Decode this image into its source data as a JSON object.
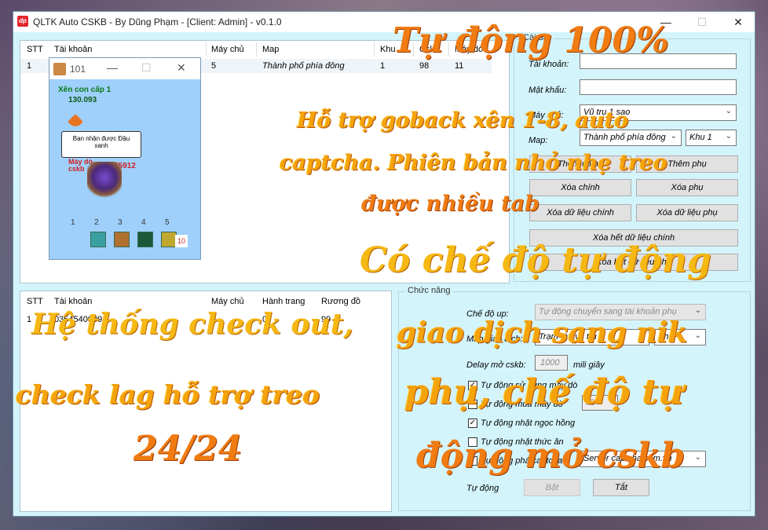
{
  "window": {
    "title": "QLTK Auto CSKB - By Dũng Phạm - [Client: Admin] - v0.1.0",
    "icon": "app-logo-icon",
    "minimize": "—",
    "maximize": "☐",
    "close": "✕"
  },
  "top_table": {
    "columns": [
      "STT",
      "Tài khoản",
      "Máy chủ",
      "Map",
      "Khu",
      "Cskb",
      "Máy dò"
    ],
    "rows": [
      {
        "stt": "1",
        "account": "",
        "server": "5",
        "map": "Thành phố phía đông",
        "zone": "1",
        "cskb": "98",
        "detector": "11"
      }
    ]
  },
  "bottom_table": {
    "columns": [
      "STT",
      "Tài khoản",
      "Máy chủ",
      "Hành trang",
      "Rương đồ"
    ],
    "rows": [
      {
        "stt": "1",
        "account": "0354540009",
        "server": "5",
        "bag": "0",
        "chest": "99"
      }
    ]
  },
  "settings": {
    "legend": "Cài đặt",
    "account_label": "Tài khoản:",
    "account_value": "",
    "password_label": "Mật khẩu:",
    "password_value": "",
    "server_label": "Máy chủ:",
    "server_value": "Vũ trụ 1 sao",
    "map_label": "Map:",
    "map_value": "Thành phố phía đông",
    "zone_value": "Khu 1",
    "buttons": {
      "add_main": "Thêm chính",
      "add_sub": "Thêm phụ",
      "delete_main": "Xóa chính",
      "delete_sub": "Xóa phụ",
      "delete_main_data": "Xóa dữ liệu chính",
      "delete_sub_data": "Xóa dữ liệu phụ",
      "delete_all_main_data": "Xóa hết dữ liệu chính",
      "delete_all_sub_data": "Xóa hết dữ liệu phụ"
    }
  },
  "features": {
    "legend": "Chức năng",
    "mode_label": "Chế độ up:",
    "mode_value": "Tự động chuyển sang tài khoản phụ",
    "trade_label": "Map giao dịch:",
    "trade_value": "Trạm tàu vũ trụ",
    "trade_zone": "Khu",
    "delay_label": "Delay mở cskb:",
    "delay_value": "1000",
    "delay_unit": "mili giây",
    "checkboxes": [
      {
        "label": "Tự động sử dụng máy dò",
        "checked": true
      },
      {
        "label": "Tự động mua máy dò",
        "checked": false,
        "extra": "x3"
      },
      {
        "label": "Tự động nhặt ngọc hồng",
        "checked": true
      },
      {
        "label": "Tự động nhặt thức ăn",
        "checked": false
      },
      {
        "label": "Tự động phá captcha",
        "checked": true
      }
    ],
    "captcha_server": "Server captcha.com.vn",
    "auto_label": "Tự động",
    "on_button": "Bật",
    "off_button": "Tắt"
  },
  "popup": {
    "title": "101",
    "mob_text": "Xên con cấp 1",
    "mob_hp": "130.093",
    "bubble": "Bạn nhận được Đậu xanh",
    "char_label": "Máy dò\ncskb",
    "char_hp": "35912",
    "zones": [
      "1",
      "2",
      "3",
      "4",
      "5"
    ],
    "slot_count": "10"
  },
  "overlays": {
    "promo1": "Tự động 100%",
    "promo2a": "Hỗ trợ goback xên 1-8, auto",
    "promo2b": "captcha. Phiên bản nhỏ nhẹ treo",
    "promo2c": "được nhiều tab",
    "promo3": "Có chế độ tự động",
    "promo4a": "giao dịch sang nik",
    "promo4b": "phụ, chế độ tự",
    "promo4c": "động mở cskb",
    "promo5a": "Hệ thống check out,",
    "promo5b": "check lag hỗ trợ treo",
    "promo5c": "24/24"
  }
}
